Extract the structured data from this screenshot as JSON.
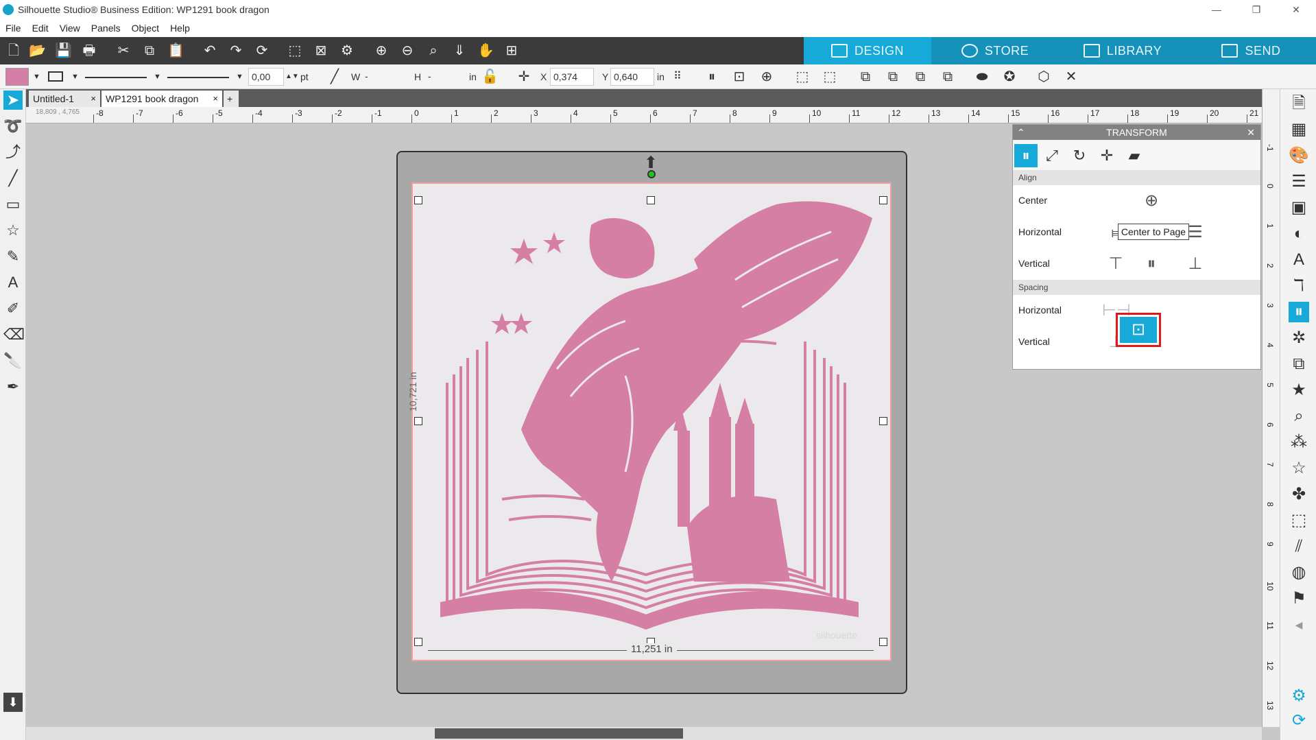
{
  "window": {
    "title": "Silhouette Studio® Business Edition: WP1291 book dragon",
    "controls": [
      "minimize",
      "restore",
      "close"
    ]
  },
  "menu": [
    "File",
    "Edit",
    "View",
    "Panels",
    "Object",
    "Help"
  ],
  "main_tabs": [
    {
      "label": "DESIGN",
      "active": true
    },
    {
      "label": "STORE",
      "active": false
    },
    {
      "label": "LIBRARY",
      "active": false
    },
    {
      "label": "SEND",
      "active": false
    }
  ],
  "properties_bar": {
    "fill_color": "#d47fa3",
    "stroke_weight": "0,00",
    "stroke_unit": "pt",
    "width_label": "W",
    "width_value": "-",
    "height_label": "H",
    "height_value": "-",
    "size_unit": "in",
    "x_label": "X",
    "x_value": "0,374",
    "y_label": "Y",
    "y_value": "0,640",
    "position_unit": "in"
  },
  "doc_tabs": [
    {
      "label": "Untitled-1",
      "close": "×"
    },
    {
      "label": "WP1291 book dragon",
      "close": "×"
    },
    {
      "label": "+",
      "close": ""
    }
  ],
  "ruler": {
    "cursor_readout": "18,809 , 4,765",
    "h_numbers": [
      "-8",
      "-7",
      "-6",
      "-5",
      "-4",
      "-3",
      "-2",
      "-1",
      "0",
      "1",
      "2",
      "3",
      "4",
      "5",
      "6",
      "7",
      "8",
      "9",
      "10",
      "11",
      "12",
      "13",
      "14",
      "15",
      "16",
      "17",
      "18",
      "19",
      "20",
      "21"
    ],
    "v_numbers": [
      "-1",
      "0",
      "1",
      "2",
      "3",
      "4",
      "5",
      "6",
      "7",
      "8",
      "9",
      "10",
      "11",
      "12",
      "13"
    ]
  },
  "canvas": {
    "width_dim": "11,251 in",
    "height_dim": "10,721 in",
    "watermark": "silhouette"
  },
  "transform_panel": {
    "title": "TRANSFORM",
    "tabs": [
      "align",
      "scale",
      "rotate",
      "move",
      "shear"
    ],
    "align_section": "Align",
    "rows": [
      {
        "label": "Center"
      },
      {
        "label": "Horizontal"
      },
      {
        "label": "Vertical"
      }
    ],
    "spacing_section": "Spacing",
    "spacing_rows": [
      {
        "label": "Horizontal"
      },
      {
        "label": "Vertical"
      }
    ],
    "tooltip": "Center to Page"
  },
  "colors": {
    "accent": "#17a9d8",
    "toolbar_dark": "#3b3b3b",
    "design_pink": "#d47fa3",
    "highlight_red": "#e01a1a"
  }
}
